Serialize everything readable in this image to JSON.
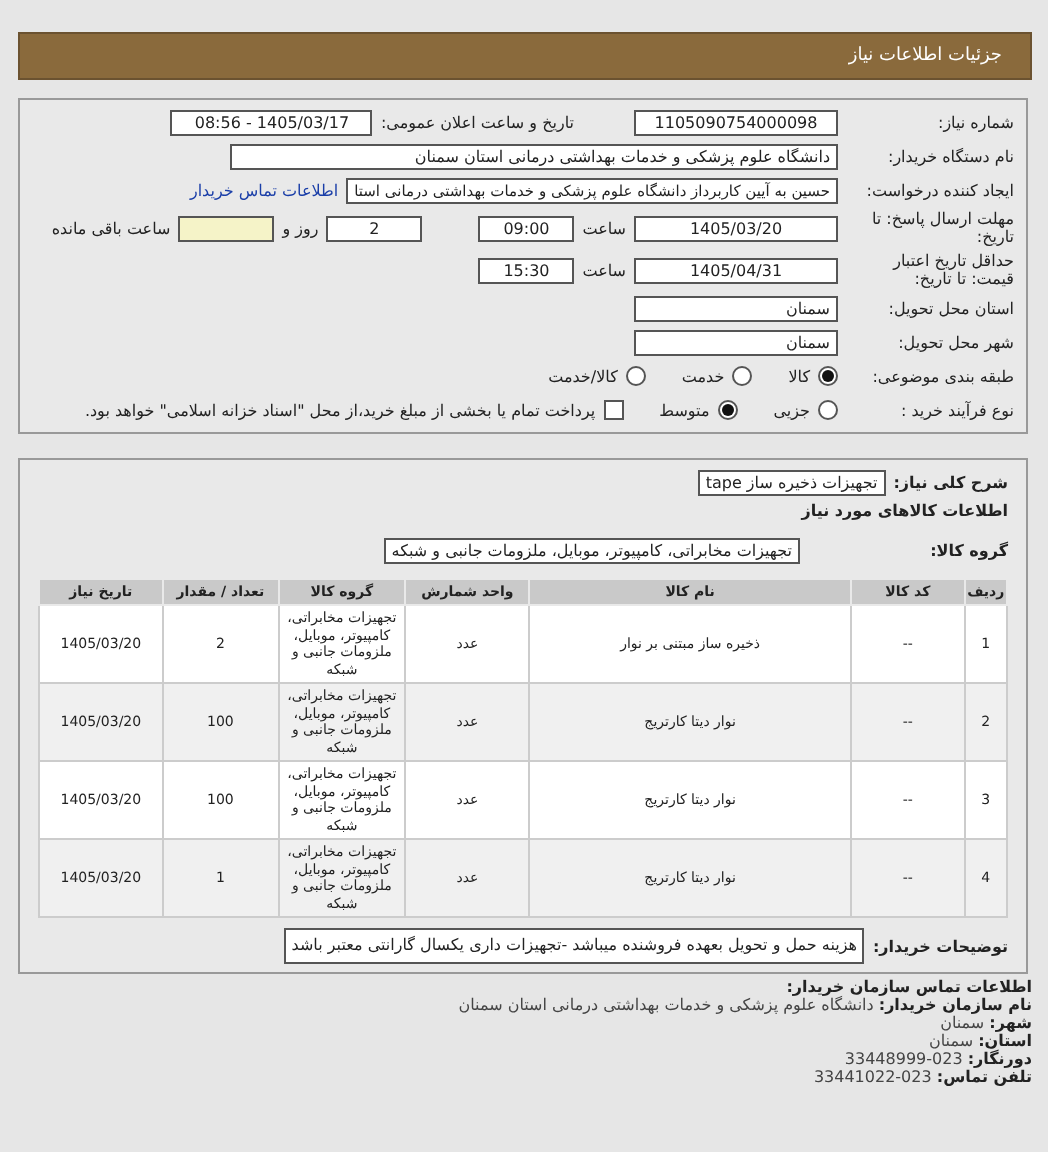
{
  "header": {
    "title": "جزئیات اطلاعات نیاز"
  },
  "details": {
    "need_number": {
      "label": "شماره نیاز:",
      "value": "1105090754000098"
    },
    "announce": {
      "label": "تاریخ و ساعت اعلان عمومی:",
      "value": "1405/03/17 - 08:56"
    },
    "buyer": {
      "label": "نام دستگاه خریدار:",
      "value": "دانشگاه علوم پزشکی و خدمات بهداشتی  درمانی استان سمنان"
    },
    "requester": {
      "label": "ایجاد کننده درخواست:",
      "value": "حسین به آیین کاربرداز دانشگاه علوم پزشکی و خدمات بهداشتی  درمانی استا",
      "link": "اطلاعات تماس خریدار"
    },
    "deadline": {
      "label": "مهلت ارسال پاسخ: تا تاریخ:",
      "date": "1405/03/20",
      "time_label": "ساعت",
      "time": "09:00",
      "days": "2",
      "days_label": "روز و",
      "hours_label": "ساعت باقی مانده"
    },
    "validity": {
      "label": "حداقل تاریخ اعتبار قیمت: تا تاریخ:",
      "date": "1405/04/31",
      "time_label": "ساعت",
      "time": "15:30"
    },
    "province": {
      "label": "استان محل تحویل:",
      "value": "سمنان"
    },
    "city": {
      "label": "شهر محل تحویل:",
      "value": "سمنان"
    },
    "category": {
      "label": "طبقه بندی موضوعی:",
      "options": [
        {
          "label": "کالا",
          "selected": true
        },
        {
          "label": "خدمت",
          "selected": false
        },
        {
          "label": "کالا/خدمت",
          "selected": false
        }
      ]
    },
    "process": {
      "label": "نوع فرآیند خرید :",
      "options": [
        {
          "label": "جزیی",
          "selected": false
        },
        {
          "label": "متوسط",
          "selected": true
        }
      ],
      "treasury": {
        "label": "پرداخت تمام یا بخشی از مبلغ خرید،از محل \"اسناد خزانه اسلامی\" خواهد بود.",
        "checked": false
      }
    }
  },
  "goods": {
    "summary": {
      "label": "شرح کلی نیاز:",
      "value": "تجهیزات ذخیره ساز tape"
    },
    "heading": "اطلاعات کالاهای مورد نیاز",
    "group": {
      "label": "گروه کالا:",
      "value": "تجهیزات مخابراتی، کامپیوتر، موبایل، ملزومات جانبی و شبکه"
    },
    "table": {
      "columns": [
        "ردیف",
        "کد کالا",
        "نام کالا",
        "واحد شمارش",
        "گروه کالا",
        "تعداد / مقدار",
        "تاریخ نیاز"
      ],
      "rows": [
        [
          "1",
          "--",
          "ذخیره ساز مبتنی بر نوار",
          "عدد",
          "تجهیزات مخابراتی، کامپیوتر، موبایل، ملزومات جانبی و شبکه",
          "2",
          "1405/03/20"
        ],
        [
          "2",
          "--",
          "نوار دیتا کارتریج",
          "عدد",
          "تجهیزات مخابراتی، کامپیوتر، موبایل، ملزومات جانبی و شبکه",
          "100",
          "1405/03/20"
        ],
        [
          "3",
          "--",
          "نوار دیتا کارتریج",
          "عدد",
          "تجهیزات مخابراتی، کامپیوتر، موبایل، ملزومات جانبی و شبکه",
          "100",
          "1405/03/20"
        ],
        [
          "4",
          "--",
          "نوار دیتا کارتریج",
          "عدد",
          "تجهیزات مخابراتی، کامپیوتر، موبایل، ملزومات جانبی و شبکه",
          "1",
          "1405/03/20"
        ]
      ]
    },
    "notes": {
      "label": "توضیحات خریدار:",
      "value": "هزینه حمل و تحویل بعهده فروشنده میباشد -تجهیزات داری یکسال گارانتی معتبر باشد"
    }
  },
  "contact": {
    "title": "اطلاعات تماس سازمان خریدار:",
    "lines": [
      {
        "label": "نام سازمان خریدار:",
        "value": "دانشگاه علوم پزشکی و خدمات بهداشتی درمانی استان سمنان"
      },
      {
        "label": "شهر:",
        "value": "سمنان"
      },
      {
        "label": "استان:",
        "value": "سمنان"
      },
      {
        "label": "دورنگار:",
        "value": "023-33448999"
      },
      {
        "label": "تلفن تماس:",
        "value": "023-33441022"
      }
    ]
  }
}
